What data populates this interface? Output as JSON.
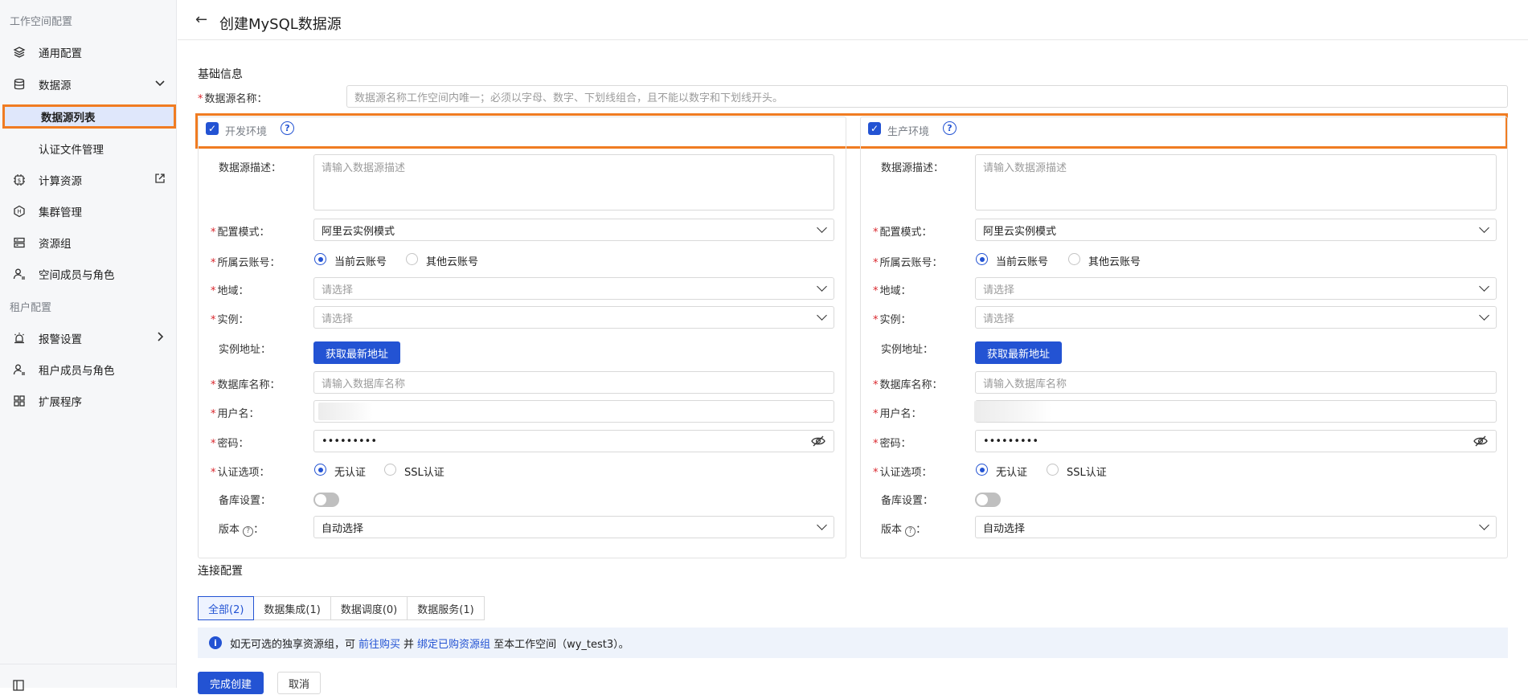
{
  "sidebar": {
    "section_workspace": "工作空间配置",
    "items": [
      {
        "label": "通用配置",
        "icon": "layers-icon"
      },
      {
        "label": "数据源",
        "icon": "database-icon"
      },
      {
        "label": "数据源列表"
      },
      {
        "label": "认证文件管理"
      },
      {
        "label": "计算资源",
        "icon": "chip-icon"
      },
      {
        "label": "集群管理",
        "icon": "hexagon-icon"
      },
      {
        "label": "资源组",
        "icon": "server-icon"
      },
      {
        "label": "空间成员与角色",
        "icon": "user-icon"
      }
    ],
    "section_tenant": "租户配置",
    "tenant_items": [
      {
        "label": "报警设置",
        "icon": "alarm-icon"
      },
      {
        "label": "租户成员与角色",
        "icon": "user-icon"
      },
      {
        "label": "扩展程序",
        "icon": "grid-icon"
      }
    ]
  },
  "header": {
    "back_glyph": "←",
    "title": "创建MySQL数据源"
  },
  "basic": {
    "title": "基础信息",
    "name_label": "数据源名称：",
    "name_placeholder": "数据源名称工作空间内唯一；必须以字母、数字、下划线组合，且不能以数字和下划线开头。"
  },
  "env": {
    "dev_label": "开发环境",
    "prod_label": "生产环境",
    "check": "✓",
    "help": "?"
  },
  "form": {
    "desc_label": "数据源描述：",
    "desc_placeholder": "请输入数据源描述",
    "mode_label": "配置模式：",
    "mode_value": "阿里云实例模式",
    "account_label": "所属云账号：",
    "account_current": "当前云账号",
    "account_other": "其他云账号",
    "region_label": "地域：",
    "region_placeholder": "请选择",
    "instance_label": "实例：",
    "instance_placeholder": "请选择",
    "address_label": "实例地址：",
    "address_button": "获取最新地址",
    "db_label": "数据库名称：",
    "db_placeholder": "请输入数据库名称",
    "user_label": "用户名：",
    "pwd_label": "密码：",
    "pwd_value": "•••••••••",
    "auth_label": "认证选项：",
    "auth_none": "无认证",
    "auth_ssl": "SSL认证",
    "backup_label": "备库设置：",
    "version_label": "版本",
    "version_help": "?",
    "version_colon": "：",
    "version_value": "自动选择"
  },
  "connection": {
    "title": "连接配置",
    "tabs": [
      "全部(2)",
      "数据集成(1)",
      "数据调度(0)",
      "数据服务(1)"
    ],
    "notice_icon": "i",
    "notice_pre": "如无可选的独享资源组，可",
    "notice_link1": "前往购买",
    "notice_mid": "并",
    "notice_link2": "绑定已购资源组",
    "notice_post": "至本工作空间（wy_test3）。"
  },
  "footer": {
    "create": "完成创建",
    "cancel": "取消"
  },
  "colors": {
    "primary": "#2353d3",
    "highlight": "#f07c22",
    "required": "#d9262c"
  }
}
